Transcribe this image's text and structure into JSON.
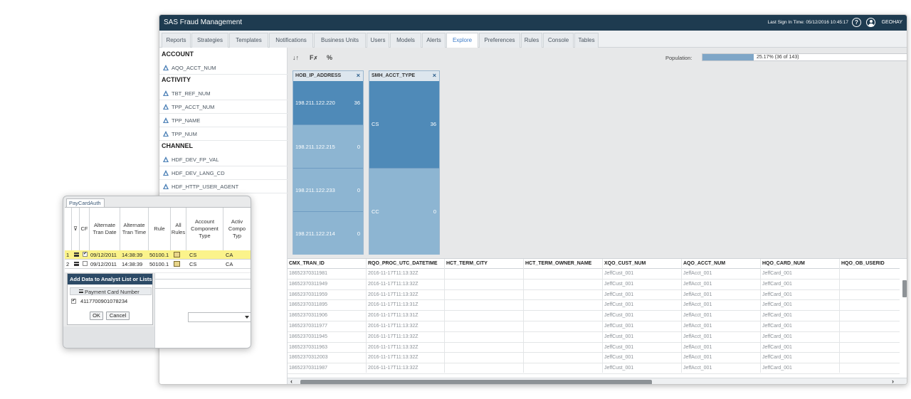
{
  "titlebar": {
    "app_title": "SAS Fraud Management",
    "last_sign_in": "Last Sign In Time: 05/12/2016 10:45:17",
    "username": "GEOHAY",
    "help_glyph": "?"
  },
  "tabs": [
    {
      "label": "Reports"
    },
    {
      "label": "Strategies"
    },
    {
      "label": "Templates"
    },
    {
      "label": "Notifications"
    },
    {
      "label": "Business Units"
    },
    {
      "label": "Users"
    },
    {
      "label": "Models"
    },
    {
      "label": "Alerts"
    },
    {
      "label": "Explore",
      "active": true
    },
    {
      "label": "Preferences"
    },
    {
      "label": "Rules"
    },
    {
      "label": "Console"
    },
    {
      "label": "Tables"
    }
  ],
  "sidebar": {
    "sections": [
      {
        "header": "ACCOUNT",
        "items": [
          "AQO_ACCT_NUM"
        ]
      },
      {
        "header": "ACTIVITY",
        "items": [
          "TBT_REF_NUM",
          "TPP_ACCT_NUM",
          "TPP_NAME",
          "TPP_NUM"
        ]
      },
      {
        "header": "CHANNEL",
        "items": [
          "HDF_DEV_FP_VAL",
          "HDF_DEV_LANG_CD",
          "HDF_HTTP_USER_AGENT"
        ]
      }
    ]
  },
  "toolbar": {
    "sort_glyph": "↓↑",
    "clear_glyph": "✗",
    "percent_glyph": "%"
  },
  "population": {
    "label": "Population:",
    "text": "25.17% (36 of 143)",
    "fraction": 0.2517
  },
  "facets": [
    {
      "title": "HOB_IP_ADDRESS",
      "close_glyph": "×",
      "cells": [
        {
          "value": "198.211.122.220",
          "count": "36",
          "color": "#4f8ab8"
        },
        {
          "value": "198.211.122.215",
          "count": "0",
          "color": "#8db5d2"
        },
        {
          "value": "198.211.122.233",
          "count": "0",
          "color": "#8db5d2"
        },
        {
          "value": "198.211.122.214",
          "count": "0",
          "color": "#8db5d2"
        }
      ]
    },
    {
      "title": "SMH_ACCT_TYPE",
      "close_glyph": "×",
      "cells": [
        {
          "value": "CS",
          "count": "36",
          "color": "#4f8ab8"
        },
        {
          "value": "CC",
          "count": "0",
          "color": "#8db5d2"
        }
      ]
    }
  ],
  "grid": {
    "columns": [
      "CMX_TRAN_ID",
      "RQO_PROC_UTC_DATETIME",
      "HCT_TERM_CITY",
      "HCT_TERM_OWNER_NAME",
      "XQO_CUST_NUM",
      "AQO_ACCT_NUM",
      "HQO_CARD_NUM",
      "HQO_OB_USERID"
    ],
    "rows": [
      [
        "18652370311981",
        "2016-11-17T11:13:32Z",
        "",
        "",
        "JeffCust_001",
        "JeffAcct_001",
        "JeffCard_001",
        ""
      ],
      [
        "18652370311949",
        "2016-11-17T11:13:32Z",
        "",
        "",
        "JeffCust_001",
        "JeffAcct_001",
        "JeffCard_001",
        ""
      ],
      [
        "18652370311959",
        "2016-11-17T11:13:32Z",
        "",
        "",
        "JeffCust_001",
        "JeffAcct_001",
        "JeffCard_001",
        ""
      ],
      [
        "18652370311895",
        "2016-11-17T11:13:31Z",
        "",
        "",
        "JeffCust_001",
        "JeffAcct_001",
        "JeffCard_001",
        ""
      ],
      [
        "18652370311906",
        "2016-11-17T11:13:31Z",
        "",
        "",
        "JeffCust_001",
        "JeffAcct_001",
        "JeffCard_001",
        ""
      ],
      [
        "18652370311977",
        "2016-11-17T11:13:32Z",
        "",
        "",
        "JeffCust_001",
        "JeffAcct_001",
        "JeffCard_001",
        ""
      ],
      [
        "18652370311945",
        "2016-11-17T11:13:32Z",
        "",
        "",
        "JeffCust_001",
        "JeffAcct_001",
        "JeffCard_001",
        ""
      ],
      [
        "18652370311963",
        "2016-11-17T11:13:32Z",
        "",
        "",
        "JeffCust_001",
        "JeffAcct_001",
        "JeffCard_001",
        ""
      ],
      [
        "18652370312003",
        "2016-11-17T11:13:32Z",
        "",
        "",
        "JeffCust_001",
        "JeffAcct_001",
        "JeffCard_001",
        ""
      ],
      [
        "18652370311987",
        "2016-11-17T11:13:32Z",
        "",
        "",
        "JeffCust_001",
        "JeffAcct_001",
        "JeffCard_001",
        ""
      ]
    ]
  },
  "popup": {
    "tab_label": "PayCardAuth",
    "columns": [
      "",
      "",
      "CF",
      "Alternate Tran Date",
      "Alternate Tran Time",
      "Rule",
      "All Rules",
      "Account Component Type",
      "Activ Compo Typ"
    ],
    "rows": [
      {
        "num": "1",
        "checked": true,
        "date": "09/12/2011",
        "time": "14:38:39",
        "rule": "50100.1",
        "acct_type": "CS",
        "act_type": "CA",
        "selected": true
      },
      {
        "num": "2",
        "checked": false,
        "date": "09/12/2011",
        "time": "14:38:39",
        "rule": "50100.1",
        "acct_type": "CS",
        "act_type": "CA",
        "selected": false
      }
    ],
    "add_panel": {
      "title": "Add Data to Analyst List or Lists",
      "column_header": "Payment Card Number",
      "value": "4117700901078234",
      "value_checked": true,
      "ok_label": "OK",
      "cancel_label": "Cancel"
    }
  }
}
